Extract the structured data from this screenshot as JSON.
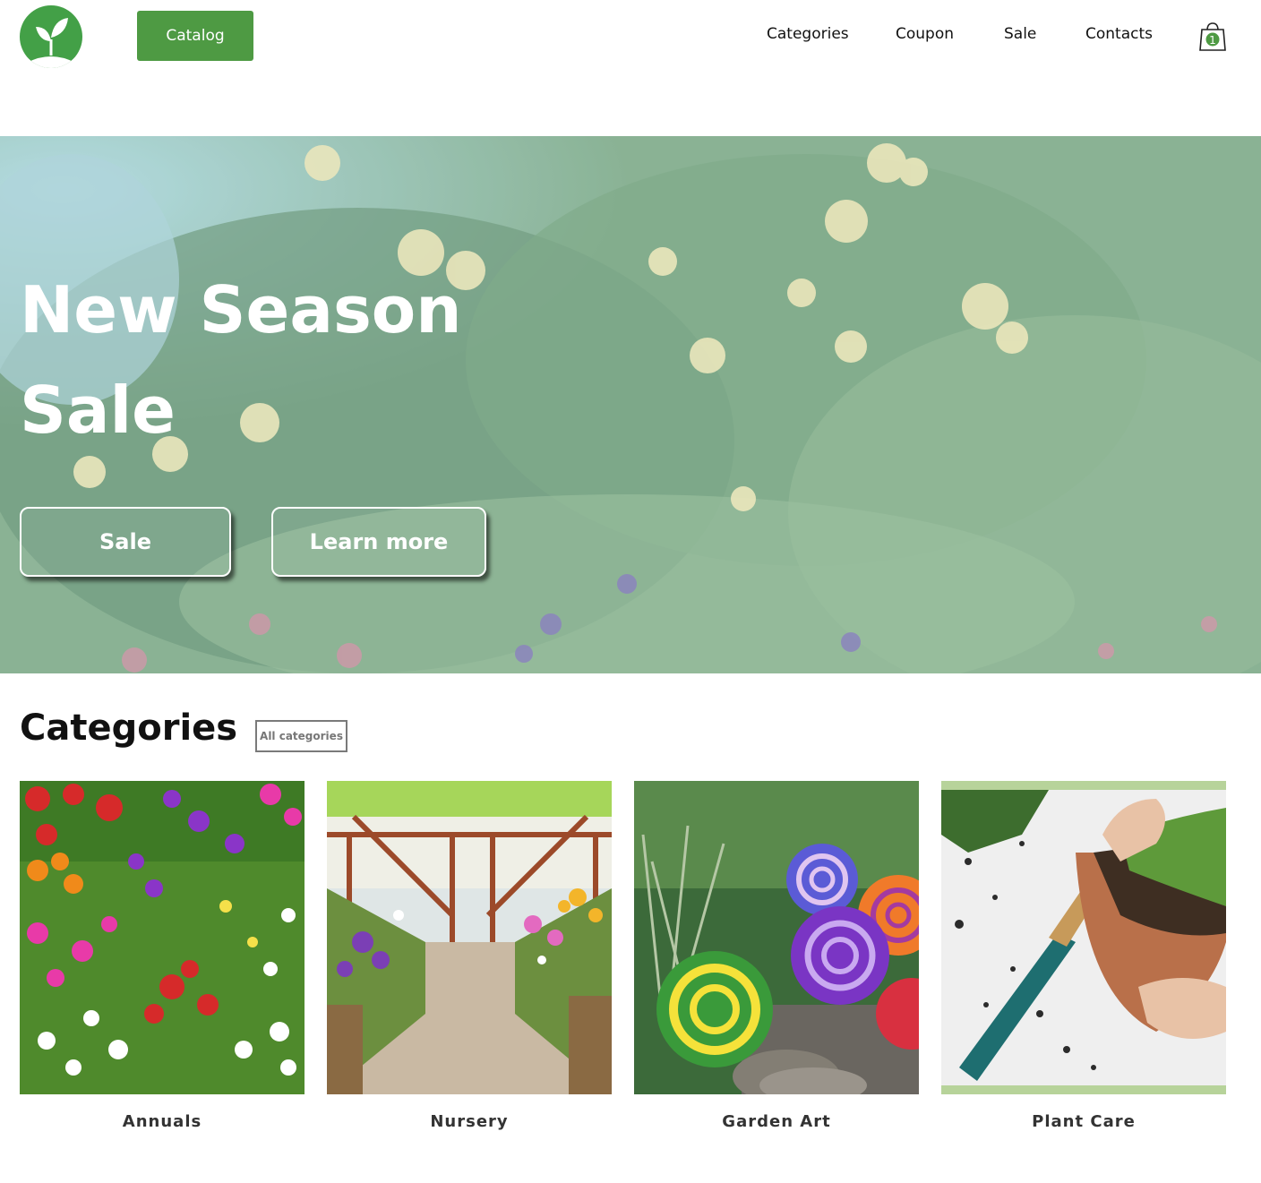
{
  "header": {
    "logo_icon": "sprout-icon",
    "catalog_label": "Catalog",
    "nav": [
      "Categories",
      "Coupon",
      "Sale",
      "Contacts"
    ],
    "cart_count": "1",
    "brand_color": "#4e9a43"
  },
  "hero": {
    "title_line1": "New Season",
    "title_line2": "Sale",
    "sale_button": "Sale",
    "learn_button": "Learn more"
  },
  "categories": {
    "heading": "Categories",
    "all_button": "All categories",
    "items": [
      {
        "label": "Annuals",
        "image": "flower-beds-photo"
      },
      {
        "label": "Nursery",
        "image": "greenhouse-aisle-photo"
      },
      {
        "label": "Garden Art",
        "image": "spiral-snail-sculptures-photo"
      },
      {
        "label": "Plant Care",
        "image": "potting-plant-photo"
      }
    ]
  }
}
